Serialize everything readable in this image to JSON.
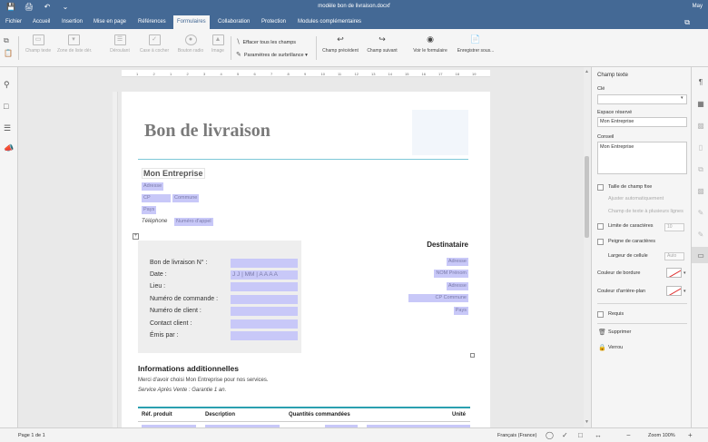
{
  "titlebar": {
    "title": "modèle bon de livraison.docxf",
    "user": "May",
    "qa_icons": [
      "save-icon",
      "print-icon",
      "undo-icon",
      "redo-icon"
    ]
  },
  "menu": {
    "tabs": [
      "Fichier",
      "Accueil",
      "Insertion",
      "Mise en page",
      "Références",
      "Formulaires",
      "Collaboration",
      "Protection",
      "Modules complémentaires"
    ],
    "active": "Formulaires"
  },
  "toolbar": {
    "disabled_buttons": [
      "Champ texte",
      "Zone de liste dér.",
      "Déroulant",
      "Case à cocher",
      "Bouton radio",
      "Image"
    ],
    "clear_fields": "Effacer tous les champs",
    "highlight_settings": "Paramètres de surbrillance",
    "prev_field": "Champ précédent",
    "next_field": "Champ suivant",
    "view_form": "Voir le formulaire",
    "save_as": "Enregistrer sous..."
  },
  "ruler": {
    "marks": [
      "1",
      "2",
      "1",
      "2",
      "3",
      "4",
      "5",
      "6",
      "7",
      "8",
      "9",
      "10",
      "11",
      "12",
      "13",
      "14",
      "15",
      "16",
      "17",
      "18",
      "19"
    ]
  },
  "document": {
    "heading": "Bon de livraison",
    "company": "Mon Entreprise",
    "address_fields": {
      "adresse": "Adresse",
      "cp": "CP",
      "commune": "Commune",
      "pays": "Pays",
      "telephone_label": "Téléphone",
      "telephone_value": "Numéro d'appel"
    },
    "delivery_fields": [
      {
        "label": "Bon de livraison N° :",
        "value": ""
      },
      {
        "label": "Date :",
        "value": "J J | MM | A A A A"
      },
      {
        "label": "Lieu :",
        "value": ""
      },
      {
        "label": "Numéro de commande :",
        "value": ""
      },
      {
        "label": "Numéro de client :",
        "value": ""
      },
      {
        "label": "Contact client :",
        "value": ""
      },
      {
        "label": "Émis par :",
        "value": ""
      }
    ],
    "recipient": {
      "title": "Destinataire",
      "fields": [
        "Adresse",
        "NOM Prénom",
        "Adresse",
        "CP Commune",
        "Pays"
      ]
    },
    "info": {
      "title": "Informations additionnelles",
      "line1": "Merci d'avoir choisi Mon Entreprise pour nos services.",
      "line2": "Service Après Vente : Garantie 1 an."
    },
    "table_headers": [
      "Réf. produit",
      "Description",
      "Quantités commandées",
      "Unité"
    ]
  },
  "panel": {
    "title": "Champ texte",
    "key_label": "Clé",
    "key_value": "",
    "placeholder_label": "Espace réservé",
    "placeholder_value": "Mon Entreprise",
    "tip_label": "Conseil",
    "tip_value": "Mon Entreprise",
    "fixed_size": "Taille de champ fixe",
    "autofit": "Ajuster automatiquement",
    "multiline": "Champ de texte à plusieurs lignes",
    "char_limit": "Limite de caractères",
    "char_limit_value": "10",
    "comb": "Peigne de caractères",
    "cell_width": "Largeur de cellule",
    "cell_width_value": "Auto",
    "border_color": "Couleur de bordure",
    "bg_color": "Couleur d'arrière-plan",
    "required": "Requis",
    "delete": "Supprimer",
    "lock": "Verrou"
  },
  "statusbar": {
    "page": "Page 1 de 1",
    "language": "Français (France)",
    "zoom": "Zoom 100%"
  },
  "colors": {
    "brand": "#446995",
    "field_highlight": "#c8c8f8",
    "accent_line": "#2aa0b0"
  }
}
